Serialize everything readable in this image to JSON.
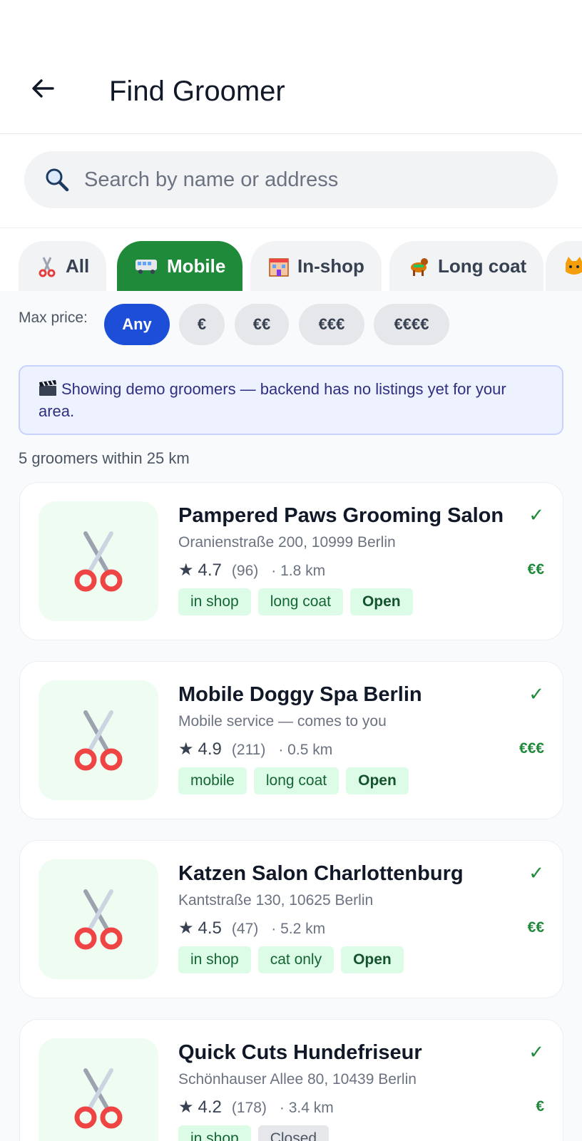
{
  "header": {
    "title": "Find Groomer"
  },
  "search": {
    "placeholder": "Search by name or address",
    "value": ""
  },
  "filters": {
    "chips": [
      {
        "icon": "scissors-icon",
        "label": "All",
        "active": false
      },
      {
        "icon": "van-icon",
        "label": "Mobile",
        "active": true
      },
      {
        "icon": "shop-icon",
        "label": "In-shop",
        "active": false
      },
      {
        "icon": "dog-icon",
        "label": "Long coat",
        "active": false
      },
      {
        "icon": "cat-icon",
        "label": "",
        "active": false
      }
    ],
    "price_label": "Max price:",
    "prices": [
      {
        "label": "Any",
        "active": true
      },
      {
        "label": "€",
        "active": false
      },
      {
        "label": "€€",
        "active": false
      },
      {
        "label": "€€€",
        "active": false
      },
      {
        "label": "€€€€",
        "active": false
      }
    ]
  },
  "banner": {
    "icon": "clapper-icon",
    "text": "Showing demo groomers — backend has no listings yet for your area."
  },
  "results": {
    "count_text": "5 groomers within 25 km",
    "items": [
      {
        "name": "Pampered Paws Grooming Salon",
        "address": "Oranienstraße 200, 10999 Berlin",
        "rating": "4.7",
        "reviews": "(96)",
        "distance": "· 1.8 km",
        "price": "€€",
        "verified": "✓",
        "tags": [
          "in shop",
          "long coat"
        ],
        "status": "Open"
      },
      {
        "name": "Mobile Doggy Spa Berlin",
        "address": "Mobile service — comes to you",
        "rating": "4.9",
        "reviews": "(211)",
        "distance": "· 0.5 km",
        "price": "€€€",
        "verified": "✓",
        "tags": [
          "mobile",
          "long coat"
        ],
        "status": "Open"
      },
      {
        "name": "Katzen Salon Charlottenburg",
        "address": "Kantstraße 130, 10625 Berlin",
        "rating": "4.5",
        "reviews": "(47)",
        "distance": "· 5.2 km",
        "price": "€€",
        "verified": "✓",
        "tags": [
          "in shop",
          "cat only"
        ],
        "status": "Open"
      },
      {
        "name": "Quick Cuts Hundefriseur",
        "address": "Schönhauser Allee 80, 10439 Berlin",
        "rating": "4.2",
        "reviews": "(178)",
        "distance": "· 3.4 km",
        "price": "€",
        "verified": "✓",
        "tags": [
          "in shop"
        ],
        "status": "Closed"
      }
    ]
  },
  "colors": {
    "accent_green": "#1f8a3a",
    "accent_blue": "#1d4ed8",
    "tag_bg": "#dcfce7",
    "banner_bg": "#eef2ff"
  }
}
